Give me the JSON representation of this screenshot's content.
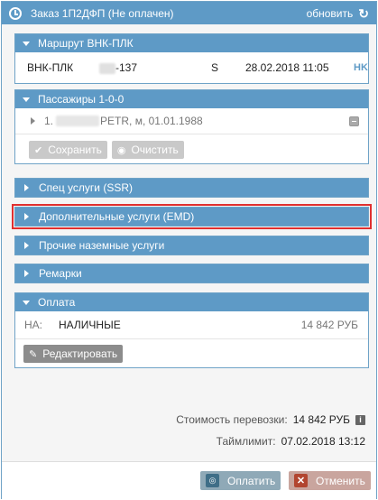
{
  "window": {
    "title": "Заказ 1П2ДФП (Не оплачен)",
    "refresh_label": "обновить"
  },
  "route_panel": {
    "title": "Маршрут ВНК-ПЛК",
    "row": {
      "route": "ВНК-ПЛК",
      "flight_suffix": "-137",
      "class": "S",
      "datetime": "28.02.2018 11:05",
      "code": "HK"
    }
  },
  "passengers_panel": {
    "title": "Пассажиры 1-0-0",
    "passenger": {
      "index": "1.",
      "name_suffix": "PETR, м, 01.01.1988"
    },
    "save_label": "Сохранить",
    "clear_label": "Очистить"
  },
  "ssr_panel": {
    "title": "Спец услуги (SSR)"
  },
  "emd_panel": {
    "title": "Дополнительные услуги (EMD)"
  },
  "ground_panel": {
    "title": "Прочие наземные услуги"
  },
  "remarks_panel": {
    "title": "Ремарки"
  },
  "payment_panel": {
    "title": "Оплата",
    "row": {
      "code": "НА:",
      "method": "НАЛИЧНЫЕ",
      "amount": "14 842 РУБ"
    },
    "edit_label": "Редактировать"
  },
  "summary": {
    "cost_label": "Стоимость перевозки:",
    "cost_value": "14 842 РУБ",
    "timelimit_label": "Таймлимит:",
    "timelimit_value": "07.02.2018 13:12"
  },
  "footer": {
    "pay_label": "Оплатить",
    "cancel_label": "Отменить"
  },
  "colors": {
    "header_blue": "#5e9ac6",
    "highlight_red": "#e03030"
  }
}
